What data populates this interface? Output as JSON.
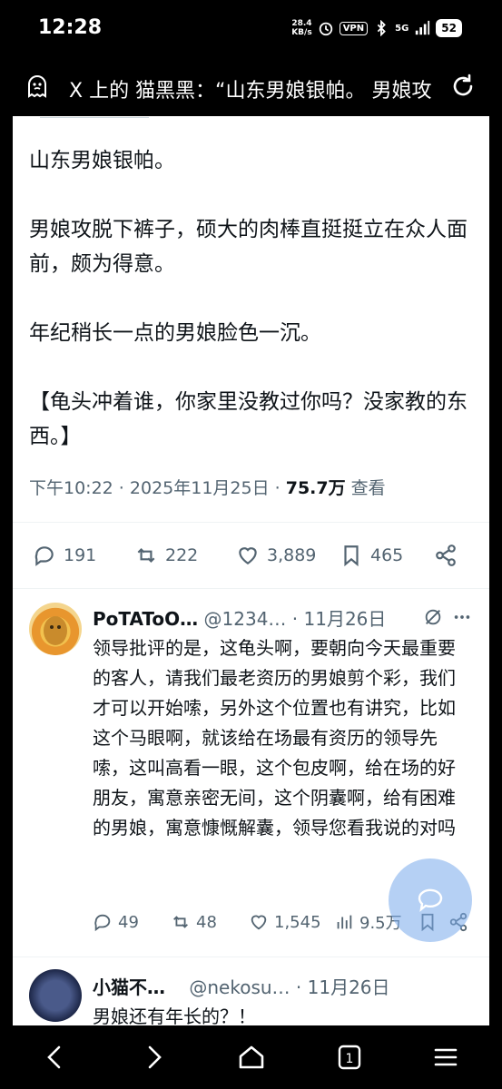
{
  "status": {
    "time": "12:28",
    "speed_value": "28.4",
    "speed_unit": "KB/s",
    "vpn": "VPN",
    "network": "5G",
    "battery": "52"
  },
  "browser": {
    "title": "X 上的 猫黑黑：“山东男娘银帕。 男娘攻"
  },
  "tweet": {
    "paragraphs": [
      "山东男娘银帕。",
      "男娘攻脱下裤子，硕大的肉棒直挺挺立在众人面前，颇为得意。",
      "年纪稍长一点的男娘脸色一沉。",
      "【龟头冲着谁，你家里没教过你吗？没家教的东西。】"
    ],
    "time": "下午10:22",
    "date": "2025年11月25日",
    "views": "75.7万",
    "views_label": "查看",
    "replies": "191",
    "reposts": "222",
    "likes": "3,889",
    "bookmarks": "465"
  },
  "replies": [
    {
      "name": "PoTAToO…",
      "handle": "@1234…",
      "date": "11月26日",
      "text": "领导批评的是，这龟头啊，要朝向今天最重要的客人，请我们最老资历的男娘剪个彩，我们才可以开始嗦，另外这个位置也有讲究，比如这个马眼啊，就该给在场最有资历的领导先嗦，这叫高看一眼，这个包皮啊，给在场的好朋友，寓意亲密无间，这个阴囊啊，给有困难的男娘，寓意慷慨解囊，领导您看我说的对吗",
      "replies": "49",
      "reposts": "48",
      "likes": "1,545",
      "views": "9.5万"
    },
    {
      "name": "小猫不…",
      "handle": "@nekosu…",
      "date": "11月26日",
      "text": "男娘还有年长的？！"
    }
  ],
  "colors": {
    "text": "#0f1419",
    "secondary": "#536471",
    "background": "#ffffff",
    "chrome": "#000000"
  }
}
